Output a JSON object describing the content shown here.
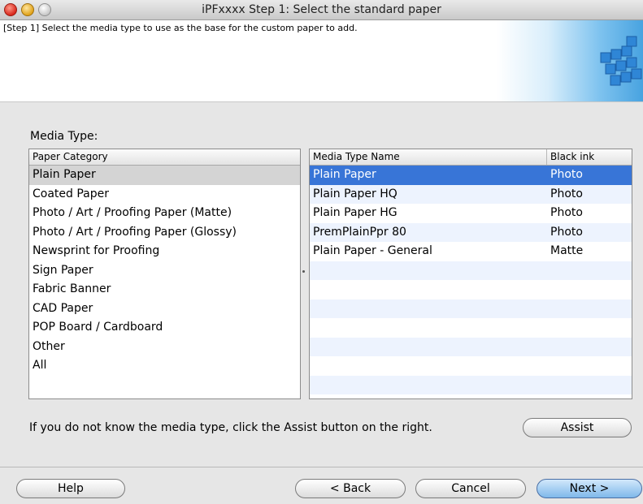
{
  "window": {
    "title": "iPFxxxx  Step 1: Select the standard paper"
  },
  "header": {
    "step_text": "[Step 1] Select the media type to use as the base for the custom paper to add."
  },
  "media_type_label": "Media Type:",
  "category_list": {
    "header": "Paper Category",
    "items": [
      "Plain Paper",
      "Coated Paper",
      "Photo / Art / Proofing Paper (Matte)",
      "Photo / Art / Proofing Paper (Glossy)",
      "Newsprint for Proofing",
      "Sign Paper",
      "Fabric Banner",
      "CAD Paper",
      "POP Board / Cardboard",
      "Other",
      "All"
    ],
    "selected": "Plain Paper"
  },
  "media_type_table": {
    "columns": [
      "Media Type Name",
      "Black ink"
    ],
    "rows": [
      {
        "name": "Plain Paper",
        "black_ink": "Photo"
      },
      {
        "name": "Plain Paper HQ",
        "black_ink": "Photo"
      },
      {
        "name": "Plain Paper HG",
        "black_ink": "Photo"
      },
      {
        "name": "PremPlainPpr 80",
        "black_ink": "Photo"
      },
      {
        "name": "Plain Paper - General",
        "black_ink": "Matte"
      }
    ],
    "selected_row": "Plain Paper"
  },
  "hint_text": "If you do not know the media type, click the Assist button on the right.",
  "buttons": {
    "assist": "Assist",
    "help": "Help",
    "back": "< Back",
    "cancel": "Cancel",
    "next": "Next >"
  },
  "colors": {
    "selection": "#3875d7",
    "default_button": "#7fb8ea"
  }
}
